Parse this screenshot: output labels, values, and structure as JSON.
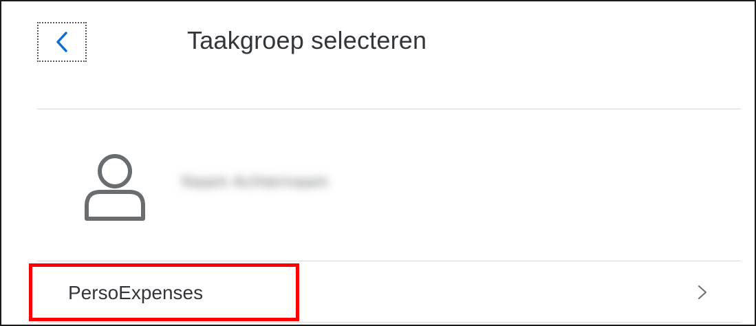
{
  "header": {
    "back_icon": "chevron-left-icon",
    "title": "Taakgroep selecteren"
  },
  "user": {
    "avatar_icon": "person-icon",
    "name_blurred": "Naam Achternaam"
  },
  "task_groups": [
    {
      "label": "PersoExpenses",
      "chevron_icon": "chevron-right-icon"
    }
  ],
  "annotation": {
    "highlight_color": "#ff0000"
  },
  "colors": {
    "accent": "#0a6ed1",
    "text": "#32363a",
    "divider": "#d9d9d9",
    "icon_gray": "#6a6d70"
  }
}
